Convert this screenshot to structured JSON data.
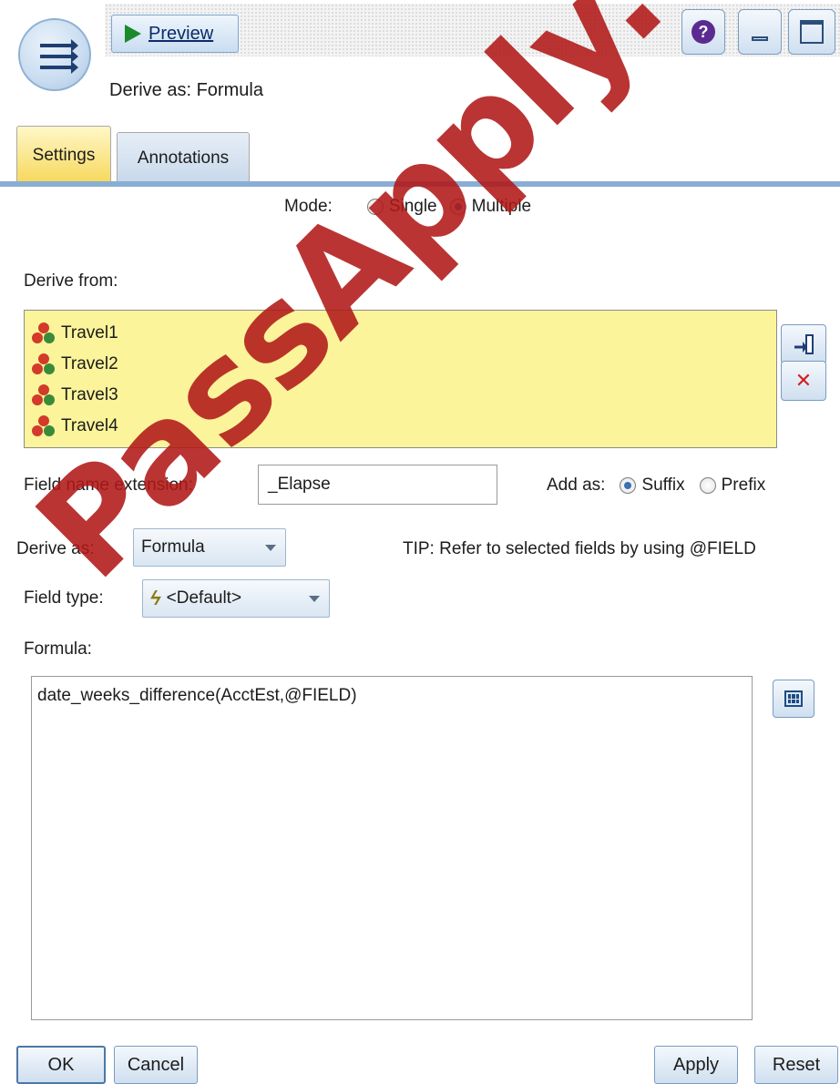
{
  "header": {
    "preview_label": "Preview",
    "subtitle": "Derive as: Formula"
  },
  "tabs": [
    {
      "label": "Settings",
      "active": true
    },
    {
      "label": "Annotations",
      "active": false
    }
  ],
  "mode": {
    "label": "Mode:",
    "options": [
      {
        "label": "Single",
        "selected": false
      },
      {
        "label": "Multiple",
        "selected": true
      }
    ]
  },
  "derive_from": {
    "label": "Derive from:",
    "fields": [
      "Travel1",
      "Travel2",
      "Travel3",
      "Travel4"
    ]
  },
  "extension": {
    "label": "Field name extension:",
    "value": "_Elapse",
    "add_as_label": "Add as:",
    "options": [
      {
        "label": "Suffix",
        "selected": true
      },
      {
        "label": "Prefix",
        "selected": false
      }
    ]
  },
  "derive_as": {
    "label": "Derive as:",
    "value": "Formula"
  },
  "tip": "TIP: Refer to selected fields by using @FIELD",
  "field_type": {
    "label": "Field type:",
    "value": "<Default>"
  },
  "formula": {
    "label": "Formula:",
    "value": "date_weeks_difference(AcctEst,@FIELD)"
  },
  "buttons": {
    "ok": "OK",
    "cancel": "Cancel",
    "apply": "Apply",
    "reset": "Reset"
  },
  "watermark": "PassApply.com",
  "colors": {
    "list_background": "#fbf49a",
    "active_tab": "#f6d85a",
    "accent": "#8aaed3",
    "watermark": "#b01818"
  },
  "icons": [
    "derive-node-icon",
    "play-icon",
    "help-icon",
    "minimize-icon",
    "maximize-icon",
    "field-set-icon",
    "move-field-icon",
    "delete-icon",
    "calculator-icon",
    "lightning-icon"
  ]
}
